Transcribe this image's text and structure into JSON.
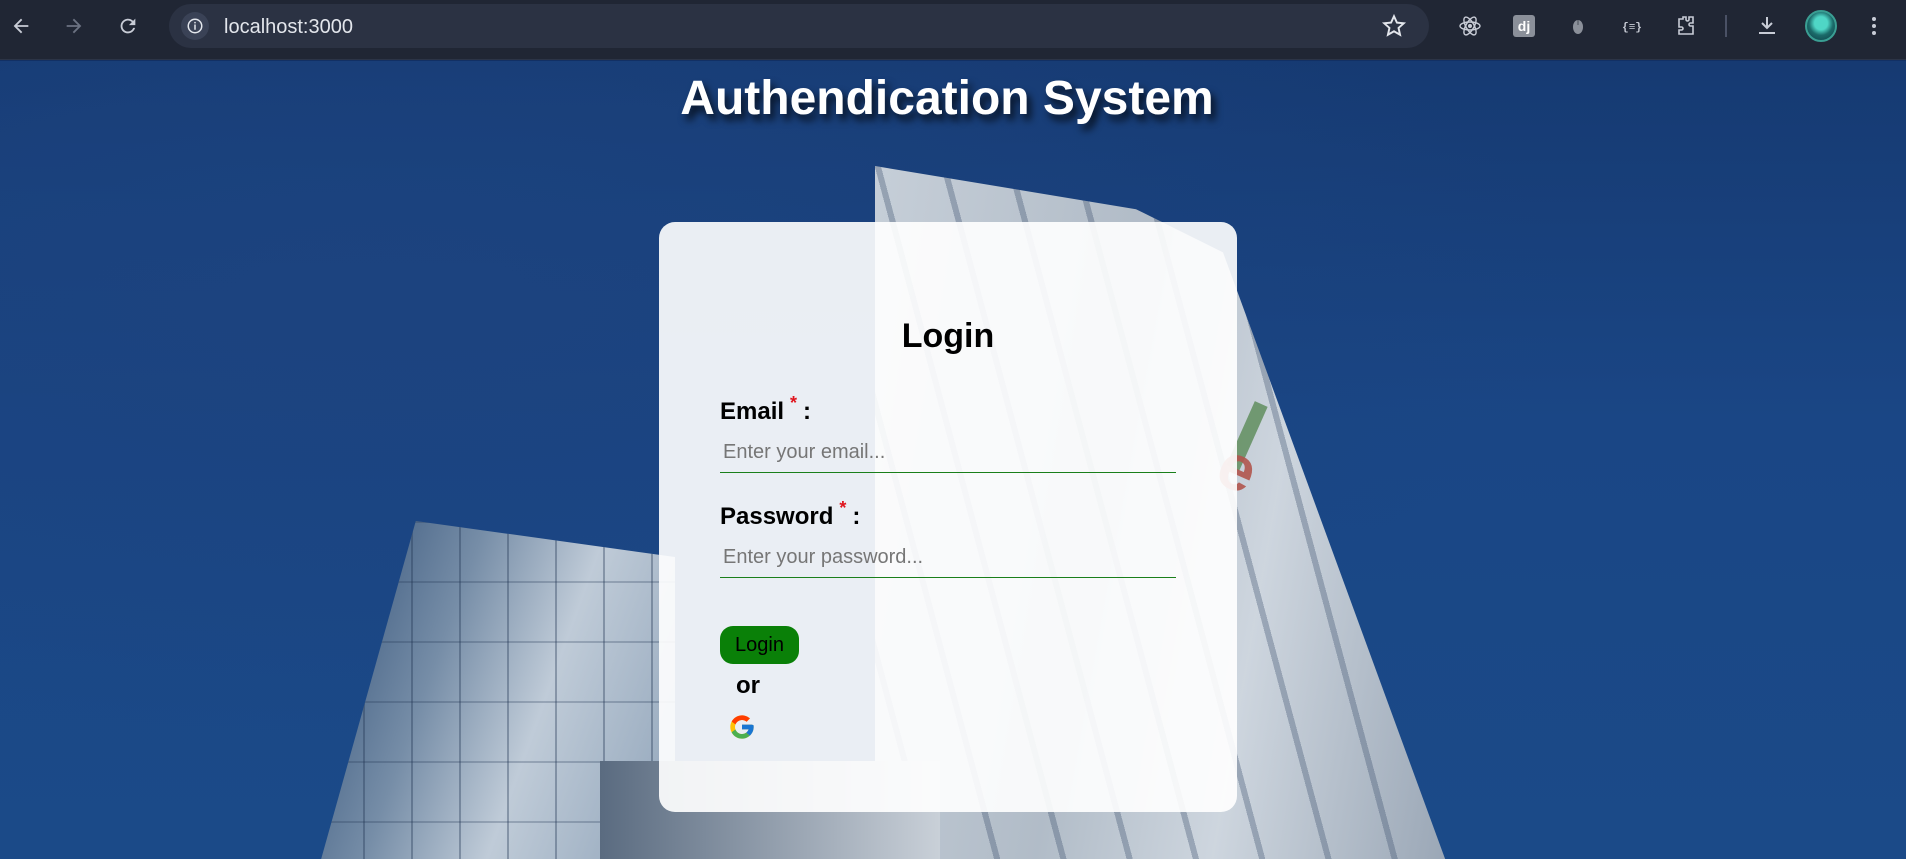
{
  "browser": {
    "url": "localhost:3000",
    "extensions": [
      "react-devtools-icon",
      "django-icon",
      "mouse-extension-icon",
      "json-formatter-icon",
      "extensions-puzzle-icon"
    ],
    "colors": {
      "chrome_bg": "#202634",
      "omnibox_bg": "#2b3243"
    }
  },
  "page": {
    "title": "Authendication System"
  },
  "login_card": {
    "title": "Login",
    "email": {
      "label": "Email",
      "required_mark": "*",
      "colon": ":",
      "placeholder": "Enter your email...",
      "value": ""
    },
    "password": {
      "label": "Password",
      "required_mark": "*",
      "colon": ":",
      "placeholder": "Enter your password...",
      "value": ""
    },
    "submit_label": "Login",
    "or_text": "or",
    "google_icon": "google-icon"
  },
  "colors": {
    "button_green": "#0a8008",
    "input_underline": "#1a7f1a",
    "required_red": "#e0141d",
    "card_bg": "rgba(255,255,255,0.91)"
  }
}
